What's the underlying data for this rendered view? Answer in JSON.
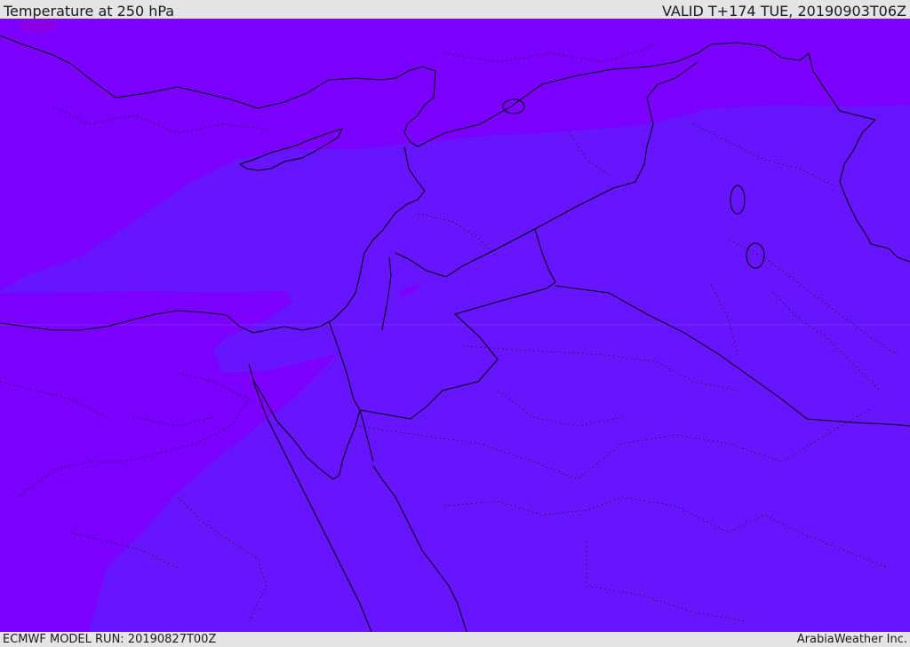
{
  "header": {
    "title": "Temperature at 250 hPa",
    "valid_time": "VALID T+174 TUE, 20190903T06Z"
  },
  "footer": {
    "model_run": "ECMWF MODEL RUN: 20190827T00Z",
    "credit": "ArabiaWeather Inc."
  },
  "map": {
    "colors": {
      "colder_band": "#7c00ff",
      "warmer_band": "#6715ff",
      "cold_core": "#8a00e6",
      "border_line": "#000000",
      "admin_line": "#1a1a3a"
    }
  }
}
